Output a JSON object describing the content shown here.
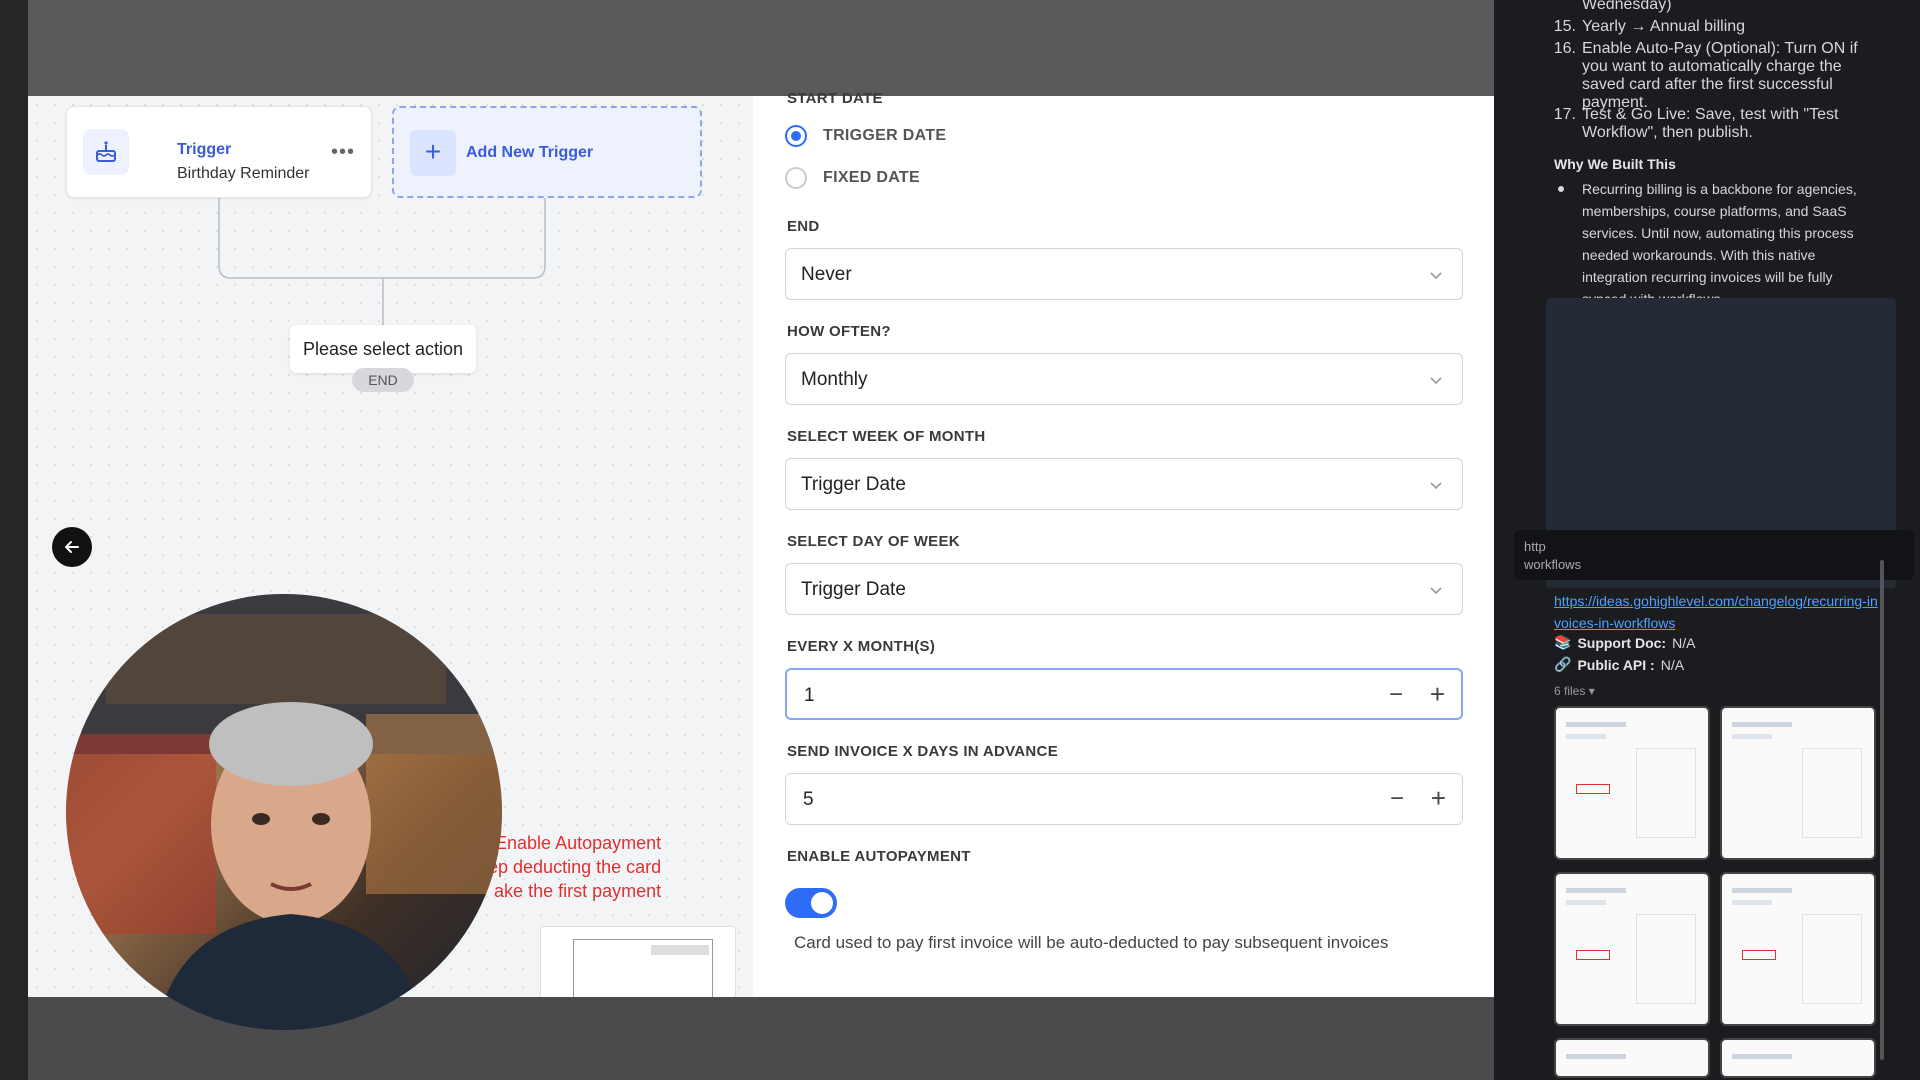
{
  "canvas": {
    "trigger_card": {
      "title": "Trigger",
      "subtitle": "Birthday Reminder",
      "more": "•••"
    },
    "add_trigger": {
      "label": "Add New Trigger"
    },
    "select_action": "Please select action",
    "end": "END",
    "annotation_lines": [
      "Enable Autopayment",
      "ep deducting the card",
      "ake the first payment"
    ]
  },
  "form": {
    "start_date_label": "START DATE",
    "radio_options": [
      {
        "label": "TRIGGER DATE",
        "selected": true
      },
      {
        "label": "FIXED DATE",
        "selected": false
      }
    ],
    "end_label": "END",
    "end_value": "Never",
    "how_often_label": "HOW OFTEN?",
    "how_often_value": "Monthly",
    "week_of_month_label": "SELECT WEEK OF MONTH",
    "week_of_month_value": "Trigger Date",
    "day_of_week_label": "SELECT DAY OF WEEK",
    "day_of_week_value": "Trigger Date",
    "every_x_months_label": "EVERY X MONTH(S)",
    "every_x_months_value": "1",
    "send_days_label": "SEND INVOICE X DAYS IN ADVANCE",
    "send_days_value": "5",
    "autopay_label": "ENABLE AUTOPAYMENT",
    "autopay_enabled": true,
    "autopay_hint": "Card used to pay first invoice will be auto-deducted to pay subsequent invoices",
    "minus_symbol": "−",
    "plus_symbol": "+"
  },
  "right_panel": {
    "top_fragment": "Wednesday)",
    "steps": [
      {
        "num": "15.",
        "text": "Yearly → Annual billing"
      },
      {
        "num": "16.",
        "text": "Enable Auto-Pay (Optional): Turn ON if you want to automatically charge the saved card after the first successful payment."
      },
      {
        "num": "17.",
        "text": "Test & Go Live: Save, test with \"Test Workflow\", then publish."
      }
    ],
    "why_heading": "Why We Built This",
    "why_text": "Recurring billing is a backbone for agencies, memberships, course platforms, and SaaS services. Until now, automating this process needed workarounds. With this native integration recurring invoices will be fully synced with workflows.",
    "tooltip_text": "http\nworkflows",
    "link": "https://ideas.gohighlevel.com/changelog/recurring-invoices-in-workflows",
    "support_doc": {
      "label": "Support Doc:",
      "value": "N/A"
    },
    "public_api": {
      "label": "Public API :",
      "value": "N/A"
    },
    "files_count": "6 files",
    "colors": {
      "link": "#4ea3ff",
      "accent": "#2f6cf6"
    }
  }
}
